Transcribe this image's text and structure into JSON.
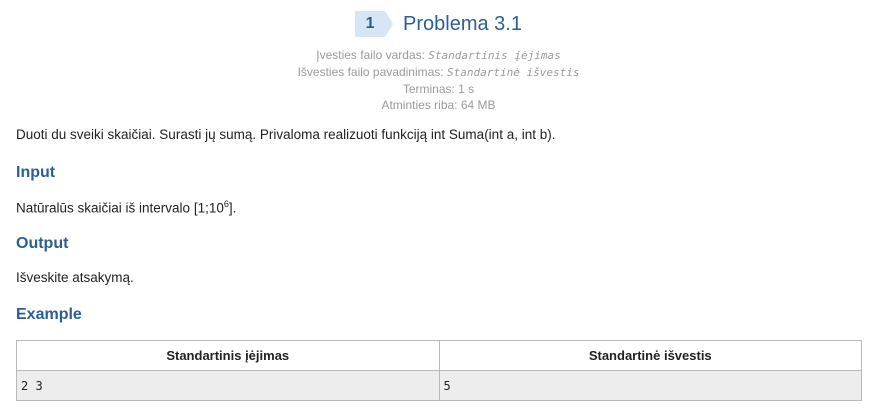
{
  "problem": {
    "number": "1",
    "title": "Problema 3.1",
    "input_file_label": "Įvesties failo vardas:",
    "input_file_value": "Standartinis įėjimas",
    "output_file_label": "Išvesties failo pavadinimas:",
    "output_file_value": "Standartinė išvestis",
    "time_limit": "Terminas: 1 s",
    "memory_limit": "Atminties riba: 64 MB"
  },
  "statement": "Duoti du sveiki skaičiai. Surasti jų sumą. Privaloma realizuoti funkciją int Suma(int a, int b).",
  "input_section": {
    "heading": "Input",
    "text_prefix": "Natūralūs skaičiai iš intervalo [1;10",
    "text_sup": "6",
    "text_suffix": "]."
  },
  "output_section": {
    "heading": "Output",
    "text": "Išveskite atsakymą."
  },
  "example_section": {
    "heading": "Example",
    "columns": [
      "Standartinis įėjimas",
      "Standartinė išvestis"
    ],
    "rows": [
      [
        "2 3",
        "5"
      ]
    ]
  },
  "colors": {
    "accent": "#2c5f93",
    "badge_bg": "#d6e6f4",
    "meta_text": "#9b9b9b",
    "cell_bg": "#ededed"
  }
}
